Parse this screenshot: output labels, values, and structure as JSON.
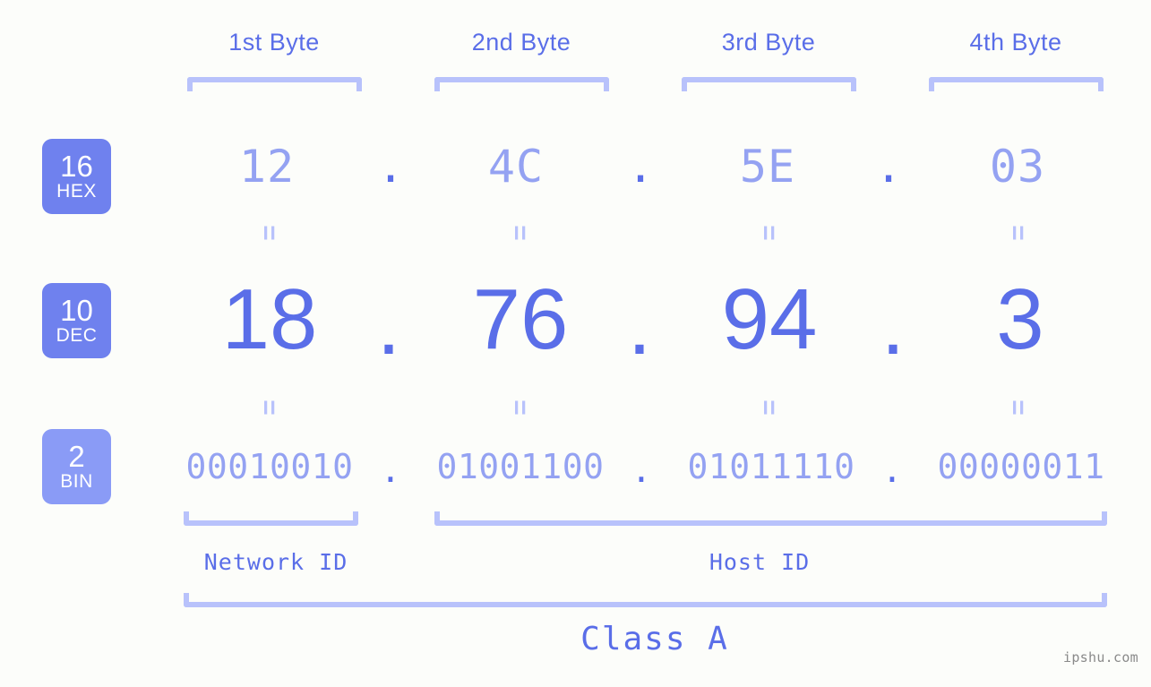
{
  "page": {
    "background_color": "#fcfdfa",
    "accent_color": "#5a6ee8",
    "accent_light_color": "#94a2f2",
    "bracket_color": "#b8c2fb",
    "badge_color": "#6f81ee",
    "badge_color_light": "#8a9bf6",
    "watermark": "ipshu.com"
  },
  "byte_headers": [
    {
      "label": "1st Byte"
    },
    {
      "label": "2nd Byte"
    },
    {
      "label": "3rd Byte"
    },
    {
      "label": "4th Byte"
    }
  ],
  "bases": [
    {
      "number": "16",
      "name": "HEX"
    },
    {
      "number": "10",
      "name": "DEC"
    },
    {
      "number": "2",
      "name": "BIN"
    }
  ],
  "rows": {
    "hex": {
      "base_number": "16",
      "base_name": "HEX",
      "values": [
        "12",
        "4C",
        "5E",
        "03"
      ],
      "separator": "."
    },
    "dec": {
      "base_number": "10",
      "base_name": "DEC",
      "values": [
        "18",
        "76",
        "94",
        "3"
      ],
      "separator": "."
    },
    "bin": {
      "base_number": "2",
      "base_name": "BIN",
      "values": [
        "00010010",
        "01001100",
        "01011110",
        "00000011"
      ],
      "separator": "."
    }
  },
  "equality_marker": "=",
  "segments": {
    "network_id": "Network ID",
    "host_id": "Host ID"
  },
  "class": {
    "label": "Class A"
  }
}
